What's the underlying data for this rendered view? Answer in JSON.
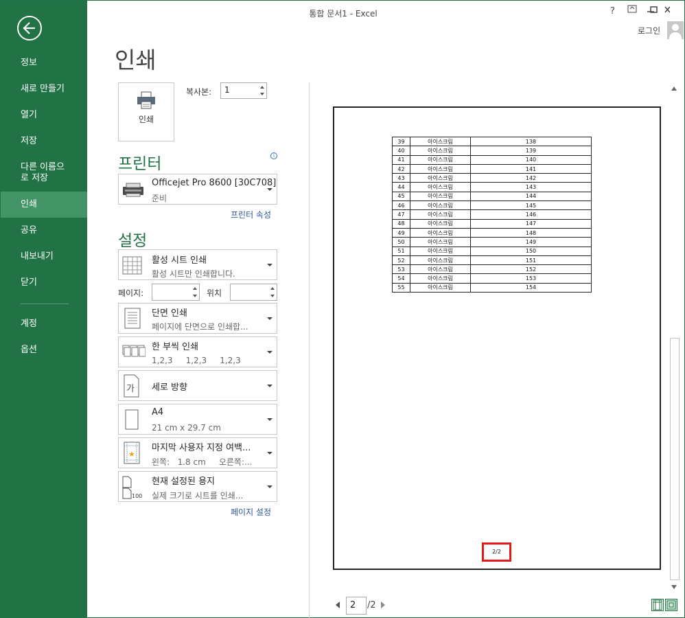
{
  "window": {
    "title": "통합 문서1 - Excel",
    "help": "?",
    "login": "로그인"
  },
  "nav": {
    "items": [
      {
        "label": "정보",
        "id": "info"
      },
      {
        "label": "새로 만들기",
        "id": "new"
      },
      {
        "label": "열기",
        "id": "open"
      },
      {
        "label": "저장",
        "id": "save"
      },
      {
        "label": "다른 이름으로 저장",
        "id": "save-as"
      },
      {
        "label": "인쇄",
        "id": "print",
        "selected": true
      },
      {
        "label": "공유",
        "id": "share"
      },
      {
        "label": "내보내기",
        "id": "export"
      },
      {
        "label": "닫기",
        "id": "close"
      },
      {
        "label": "계정",
        "id": "account"
      },
      {
        "label": "옵션",
        "id": "options"
      }
    ]
  },
  "print": {
    "title": "인쇄",
    "print_button": "인쇄",
    "copies_label": "복사본:",
    "copies_value": "1",
    "printer_section": "프린터",
    "printer": {
      "name": "Officejet Pro 8600 [30C708]",
      "status": "준비"
    },
    "printer_props_link": "프린터 속성",
    "settings_section": "설정",
    "settings": [
      {
        "id": "what",
        "line1": "활성 시트 인쇄",
        "line2": "활성 시트만 인쇄합니다.",
        "icon": "grid-sheet-icon"
      },
      {
        "id": "sides",
        "line1": "단면 인쇄",
        "line2": "페이지에 단면으로 인쇄합...",
        "icon": "single-sided-icon"
      },
      {
        "id": "collate",
        "line1": "한 부씩 인쇄",
        "line2": "1,2,3     1,2,3     1,2,3",
        "icon": "collate-icon"
      },
      {
        "id": "orientation",
        "line1": "세로 방향",
        "line2": "",
        "icon": "portrait-icon"
      },
      {
        "id": "paper",
        "line1": "A4",
        "line2": "21 cm x 29.7 cm",
        "icon": "paper-size-icon"
      },
      {
        "id": "margins",
        "line1": "마지막 사용자 지정 여백...",
        "line2": "왼쪽:   1.8 cm     오른쪽:...",
        "icon": "margins-icon"
      },
      {
        "id": "scaling",
        "line1": "현재 설정된 용지",
        "line2": "실제 크기로 시트를 인쇄...",
        "icon": "scaling-icon"
      }
    ],
    "pages_label": "페이지:",
    "pages_from": "",
    "pages_to_label": "위치",
    "pages_to": "",
    "page_setup_link": "페이지 설정"
  },
  "preview": {
    "rows": [
      [
        "39",
        "아이스크림",
        "138"
      ],
      [
        "40",
        "아이스크림",
        "139"
      ],
      [
        "41",
        "아이스크림",
        "140"
      ],
      [
        "42",
        "아이스크림",
        "141"
      ],
      [
        "43",
        "아이스크림",
        "142"
      ],
      [
        "44",
        "아이스크림",
        "143"
      ],
      [
        "45",
        "아이스크림",
        "144"
      ],
      [
        "46",
        "아이스크림",
        "145"
      ],
      [
        "47",
        "아이스크림",
        "146"
      ],
      [
        "48",
        "아이스크림",
        "147"
      ],
      [
        "49",
        "아이스크림",
        "148"
      ],
      [
        "50",
        "아이스크림",
        "149"
      ],
      [
        "51",
        "아이스크림",
        "150"
      ],
      [
        "52",
        "아이스크림",
        "151"
      ],
      [
        "53",
        "아이스크림",
        "152"
      ],
      [
        "54",
        "아이스크림",
        "153"
      ],
      [
        "55",
        "아이스크림",
        "154"
      ]
    ],
    "footer": "2/2",
    "current_page": "2",
    "total_pages": "/2"
  },
  "colors": {
    "accent": "#217346",
    "nav_selected": "#439467",
    "highlight": "#e21a1a",
    "link": "#2b579a"
  }
}
